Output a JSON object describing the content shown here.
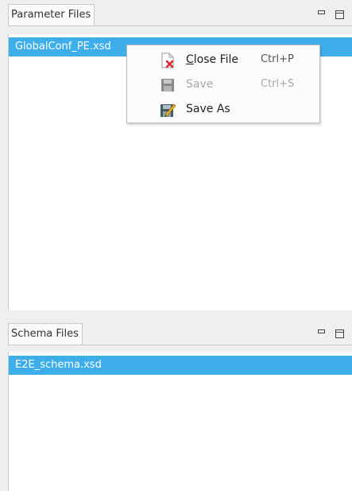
{
  "parameter_panel": {
    "tab_label": "Parameter Files",
    "files": [
      "GlobalConf_PE.xsd"
    ]
  },
  "schema_panel": {
    "tab_label": "Schema Files",
    "files": [
      "E2E_schema.xsd"
    ]
  },
  "context_menu": {
    "items": [
      {
        "mnemonic": "C",
        "label_rest": "lose File",
        "shortcut": "Ctrl+P",
        "icon": "close-file-icon",
        "enabled": true
      },
      {
        "label": "Save",
        "shortcut": "Ctrl+S",
        "icon": "save-icon",
        "enabled": false
      },
      {
        "label": "Save As",
        "shortcut": "",
        "icon": "save-as-icon",
        "enabled": true
      }
    ]
  },
  "colors": {
    "selection": "#3daee9",
    "panel_background": "#ffffff",
    "window_background": "#efefef"
  }
}
